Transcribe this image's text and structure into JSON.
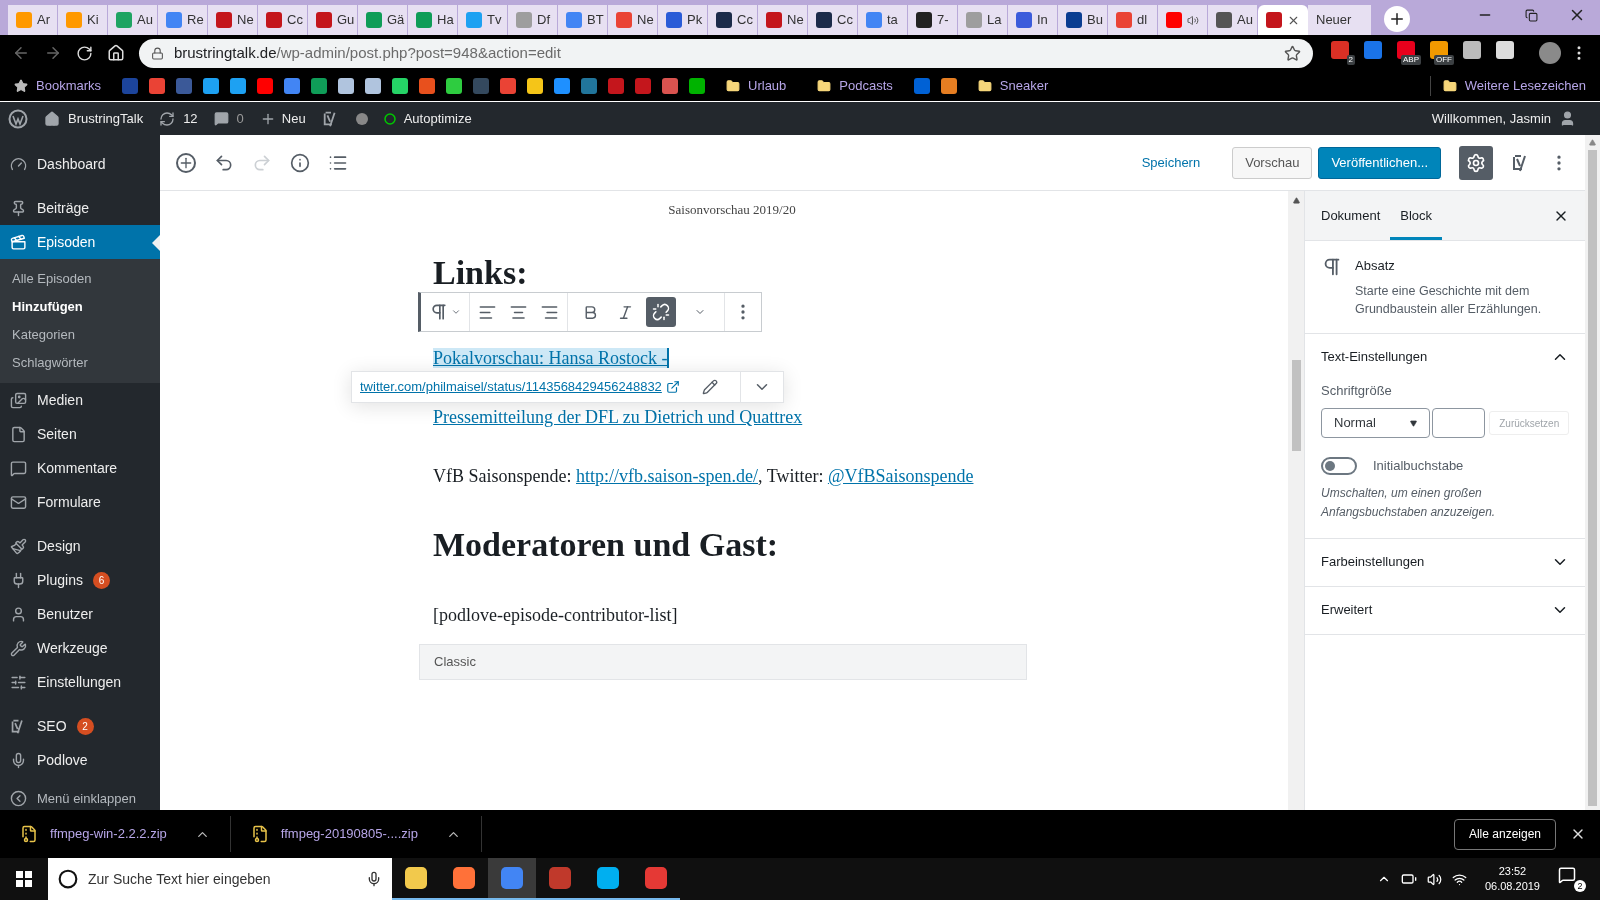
{
  "browser": {
    "tabs": [
      {
        "label": "Ar",
        "color": "#ff9900",
        "audio": false,
        "selected": false
      },
      {
        "label": "Ki",
        "color": "#ff9900",
        "audio": false,
        "selected": false
      },
      {
        "label": "Au",
        "color": "#1fa463",
        "audio": false,
        "selected": false
      },
      {
        "label": "Re",
        "color": "#4285f4",
        "audio": false,
        "selected": false
      },
      {
        "label": "Ne",
        "color": "#c4161c",
        "audio": false,
        "selected": false
      },
      {
        "label": "Cc",
        "color": "#c4161c",
        "audio": false,
        "selected": false
      },
      {
        "label": "Gu",
        "color": "#c4161c",
        "audio": false,
        "selected": false
      },
      {
        "label": "Gä",
        "color": "#0f9d58",
        "audio": false,
        "selected": false
      },
      {
        "label": "Ha",
        "color": "#0f9d58",
        "audio": false,
        "selected": false
      },
      {
        "label": "Tv",
        "color": "#1da1f2",
        "audio": false,
        "selected": false
      },
      {
        "label": "Df",
        "color": "#9e9e9e",
        "audio": false,
        "selected": false
      },
      {
        "label": "BT",
        "color": "#4285f4",
        "audio": false,
        "selected": false
      },
      {
        "label": "Ne",
        "color": "#ea4335",
        "audio": false,
        "selected": false
      },
      {
        "label": "Pk",
        "color": "#2a5bd7",
        "audio": false,
        "selected": false
      },
      {
        "label": "Cc",
        "color": "#1c2b4a",
        "audio": false,
        "selected": false
      },
      {
        "label": "Ne",
        "color": "#c4161c",
        "audio": false,
        "selected": false
      },
      {
        "label": "Cc",
        "color": "#1c2b4a",
        "audio": false,
        "selected": false
      },
      {
        "label": "ta",
        "color": "#4285f4",
        "audio": false,
        "selected": false
      },
      {
        "label": "7-",
        "color": "#222222",
        "audio": false,
        "selected": false
      },
      {
        "label": "La",
        "color": "#9e9e9e",
        "audio": false,
        "selected": false
      },
      {
        "label": "In",
        "color": "#3b5bdb",
        "audio": false,
        "selected": false
      },
      {
        "label": "Bu",
        "color": "#0a3d91",
        "audio": false,
        "selected": false
      },
      {
        "label": "dl",
        "color": "#ea4335",
        "audio": false,
        "selected": false
      },
      {
        "color": "#ff0000",
        "audio": true,
        "selected": false
      },
      {
        "label": "Au",
        "color": "#555555",
        "audio": false,
        "selected": false
      },
      {
        "color": "#c4161c",
        "audio": false,
        "selected": true
      },
      {
        "label": "Neuer",
        "audio": false,
        "selected": false
      }
    ],
    "address": {
      "host": "brustringtalk.de",
      "path": "/wp-admin/post.php?post=948&action=edit"
    },
    "extensions": [
      {
        "color": "#d93025",
        "badge": "2"
      },
      {
        "color": "#1a73e8"
      },
      {
        "color": "#e8001c",
        "badge": "ABP"
      },
      {
        "color": "#f29900",
        "badge": "OFF"
      },
      {
        "color": "#bbbbbb"
      },
      {
        "color": "#dddddd"
      }
    ],
    "bookmarks": [
      {
        "kind": "star",
        "label": "Bookmarks"
      },
      {
        "kind": "site",
        "color": "#1c449b"
      },
      {
        "kind": "site",
        "color": "#ea4335"
      },
      {
        "kind": "site",
        "color": "#3b5998"
      },
      {
        "kind": "site",
        "color": "#1da1f2"
      },
      {
        "kind": "site",
        "color": "#1da1f2"
      },
      {
        "kind": "site",
        "color": "#ff0000"
      },
      {
        "kind": "site",
        "color": "#4285f4"
      },
      {
        "kind": "site",
        "color": "#0f9d58"
      },
      {
        "kind": "site",
        "color": "#b0c4de"
      },
      {
        "kind": "site",
        "color": "#b0c4de"
      },
      {
        "kind": "site",
        "color": "#25d366"
      },
      {
        "kind": "site",
        "color": "#e8501d"
      },
      {
        "kind": "site",
        "color": "#2ecc40"
      },
      {
        "kind": "site",
        "color": "#34495e"
      },
      {
        "kind": "site",
        "color": "#ea4335"
      },
      {
        "kind": "site",
        "color": "#f5c518"
      },
      {
        "kind": "site",
        "color": "#1e90ff"
      },
      {
        "kind": "site",
        "color": "#21759b"
      },
      {
        "kind": "site",
        "color": "#c4161c"
      },
      {
        "kind": "site",
        "color": "#c4161c"
      },
      {
        "kind": "site",
        "color": "#d9534f"
      },
      {
        "kind": "site",
        "color": "#00b300"
      },
      {
        "kind": "folder",
        "label": "Urlaub"
      },
      {
        "kind": "folder",
        "label": "Podcasts"
      },
      {
        "kind": "site",
        "color": "#0061d5"
      },
      {
        "kind": "site",
        "color": "#e67e22"
      },
      {
        "kind": "folder",
        "label": "Sneaker"
      }
    ],
    "other_bookmarks": "Weitere Lesezeichen"
  },
  "admin_bar": {
    "site": "BrustringTalk",
    "updates": "12",
    "comments": "0",
    "new": "Neu",
    "plugin": "Autoptimize",
    "greeting": "Willkommen, Jasmin"
  },
  "sidebar": {
    "groups": [
      [
        {
          "label": "Dashboard",
          "selected": false
        }
      ],
      [
        {
          "label": "Beiträge",
          "selected": false
        },
        {
          "label": "Episoden",
          "selected": true,
          "children": [
            {
              "label": "Alle Episoden",
              "selected": false
            },
            {
              "label": "Hinzufügen",
              "selected": true
            },
            {
              "label": "Kategorien",
              "selected": false
            },
            {
              "label": "Schlagwörter",
              "selected": false
            }
          ]
        },
        {
          "label": "Medien",
          "selected": false
        },
        {
          "label": "Seiten",
          "selected": false
        },
        {
          "label": "Kommentare",
          "selected": false
        },
        {
          "label": "Formulare",
          "selected": false
        }
      ],
      [
        {
          "label": "Design",
          "selected": false
        },
        {
          "label": "Plugins",
          "badge": "6",
          "selected": false
        },
        {
          "label": "Benutzer",
          "selected": false
        },
        {
          "label": "Werkzeuge",
          "selected": false
        },
        {
          "label": "Einstellungen",
          "selected": false
        }
      ],
      [
        {
          "label": "SEO",
          "badge": "2",
          "selected": false
        },
        {
          "label": "Podlove",
          "selected": false
        }
      ]
    ],
    "collapse": "Menü einklappen"
  },
  "editor_header": {
    "save": "Speichern",
    "preview": "Vorschau",
    "publish": "Veröffentlichen..."
  },
  "document": {
    "title": "Saisonvorschau 2019/20",
    "blocks": [
      {
        "kind": "heading",
        "text": "Links:"
      },
      {
        "kind": "paragraph",
        "parts": [
          {
            "text": "Pokalvorschau: Hansa Rostock -",
            "link": true,
            "highlighted": true
          }
        ]
      },
      {
        "kind": "paragraph",
        "parts": [
          {
            "text": "Pressemitteilung der DFL zu Dietrich und Quattrex",
            "link": true,
            "highlighted": false
          }
        ]
      },
      {
        "kind": "paragraph",
        "parts": [
          {
            "text": "VfB Saisonspende: ",
            "link": false,
            "highlighted": false
          },
          {
            "text": "http://vfb.saison-spen.de/",
            "link": true,
            "highlighted": false
          },
          {
            "text": ", Twitter: ",
            "link": false,
            "highlighted": false
          },
          {
            "text": "@VfBSaisonspende",
            "link": true,
            "highlighted": false
          }
        ]
      },
      {
        "kind": "heading",
        "text": "Moderatoren und Gast:"
      },
      {
        "kind": "paragraph",
        "parts": [
          {
            "text": "[podlove-episode-contributor-list]",
            "link": false,
            "highlighted": false
          }
        ]
      },
      {
        "kind": "classic",
        "text": "Classic"
      }
    ],
    "link_popover": {
      "url": "twitter.com/philmaisel/status/1143568429456248832"
    }
  },
  "settings_panel": {
    "tabs": [
      {
        "label": "Dokument",
        "selected": false
      },
      {
        "label": "Block",
        "selected": true
      }
    ],
    "block": {
      "name": "Absatz",
      "description": "Starte eine Geschichte mit dem Grundbaustein aller Erzählungen."
    },
    "sections": [
      {
        "title": "Text-Einstellungen",
        "expanded": true
      },
      {
        "title": "Farbeinstellungen",
        "expanded": false
      },
      {
        "title": "Erweitert",
        "expanded": false
      }
    ],
    "font_size": {
      "label": "Schriftgröße",
      "value": "Normal",
      "reset": "Zurücksetzen"
    },
    "drop_cap": {
      "label": "Initialbuchstabe",
      "on": false,
      "help": "Umschalten, um einen großen Anfangsbuchstaben anzuzeigen."
    }
  },
  "downloads": {
    "items": [
      {
        "name": "ffmpeg-win-2.2.2.zip"
      },
      {
        "name": "ffmpeg-20190805-....zip"
      }
    ],
    "show_all": "Alle anzeigen"
  },
  "taskbar": {
    "search_placeholder": "Zur Suche Text hier eingeben",
    "apps": [
      {
        "color": "#f2c94c",
        "selected": false
      },
      {
        "color": "#ff7139",
        "selected": false
      },
      {
        "color": "#4285f4",
        "selected": true
      },
      {
        "color": "#c0392b",
        "selected": false
      },
      {
        "color": "#00aff0",
        "selected": false
      },
      {
        "color": "#e53935",
        "selected": false
      }
    ],
    "time": "23:52",
    "date": "06.08.2019",
    "notifications": "2"
  }
}
